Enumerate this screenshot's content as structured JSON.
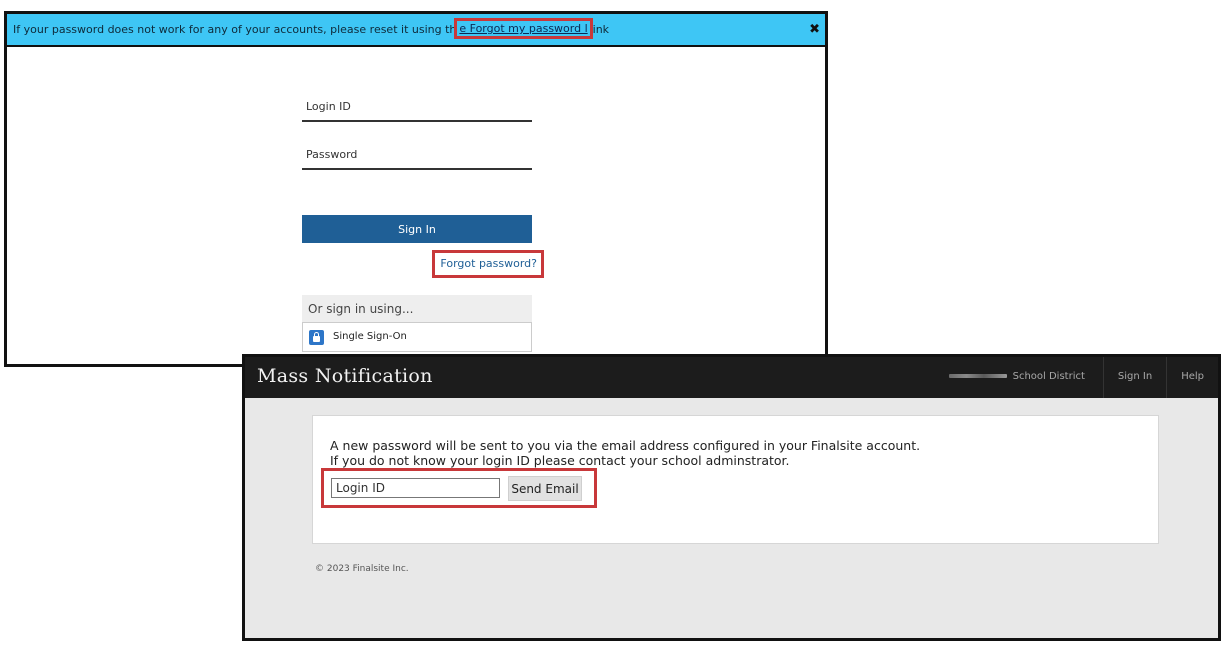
{
  "login_window": {
    "banner": {
      "text_before": "If your password does not work for any of your accounts, please reset it using th",
      "link_text": "e Forgot my password l",
      "text_after": "ink",
      "close_glyph": "✖"
    },
    "login_id_placeholder": "Login ID",
    "password_placeholder": "Password",
    "sign_in_label": "Sign In",
    "forgot_password_label": "Forgot password?",
    "alt_signin_header": "Or sign in using...",
    "sso_label": "Single Sign-On"
  },
  "mass_notification": {
    "brand": "Mass Notification",
    "nav": {
      "district": "School District",
      "sign_in": "Sign In",
      "help": "Help"
    },
    "message_line1": "A new password will be sent to you via the email address configured in your Finalsite account.",
    "message_line2": "If you do not know your login ID please contact your school adminstrator.",
    "login_id_placeholder": "Login ID",
    "send_email_label": "Send Email",
    "copyright": "© 2023 Finalsite Inc."
  },
  "colors": {
    "banner_bg": "#3ec6f5",
    "primary_button": "#1f5f96",
    "highlight_border": "#c8383a",
    "topbar_bg": "#1c1c1c"
  }
}
